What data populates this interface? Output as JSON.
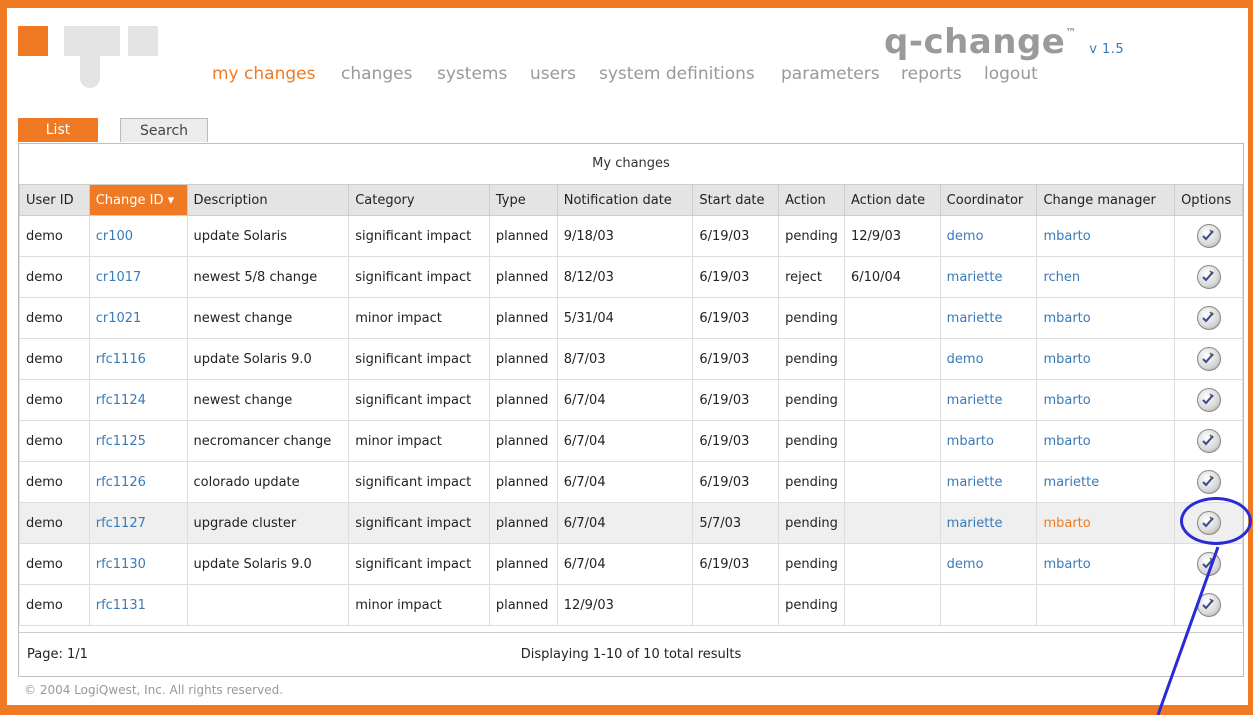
{
  "brand": {
    "name": "q-change",
    "tm": "™",
    "version": "v 1.5"
  },
  "nav": [
    "my changes",
    "changes",
    "systems",
    "users",
    "system definitions",
    "parameters",
    "reports",
    "logout"
  ],
  "tabs": {
    "list": "List",
    "search": "Search"
  },
  "table": {
    "caption": "My changes",
    "columns": [
      "User ID",
      "Change ID ▾",
      "Description",
      "Category",
      "Type",
      "Notification date",
      "Start date",
      "Action",
      "Action date",
      "Coordinator",
      "Change manager",
      "Options"
    ],
    "rows": [
      [
        "demo",
        "cr100",
        "update Solaris",
        "significant impact",
        "planned",
        "9/18/03",
        "6/19/03",
        "pending",
        "12/9/03",
        "demo",
        "mbarto"
      ],
      [
        "demo",
        "cr1017",
        "newest 5/8 change",
        "significant impact",
        "planned",
        "8/12/03",
        "6/19/03",
        "reject",
        "6/10/04",
        "mariette",
        "rchen"
      ],
      [
        "demo",
        "cr1021",
        "newest change",
        "minor impact",
        "planned",
        "5/31/04",
        "6/19/03",
        "pending",
        "",
        "mariette",
        "mbarto"
      ],
      [
        "demo",
        "rfc1116",
        "update Solaris 9.0",
        "significant impact",
        "planned",
        "8/7/03",
        "6/19/03",
        "pending",
        "",
        "demo",
        "mbarto"
      ],
      [
        "demo",
        "rfc1124",
        "newest change",
        "significant impact",
        "planned",
        "6/7/04",
        "6/19/03",
        "pending",
        "",
        "mariette",
        "mbarto"
      ],
      [
        "demo",
        "rfc1125",
        "necromancer change",
        "minor impact",
        "planned",
        "6/7/04",
        "6/19/03",
        "pending",
        "",
        "mbarto",
        "mbarto"
      ],
      [
        "demo",
        "rfc1126",
        "colorado update",
        "significant impact",
        "planned",
        "6/7/04",
        "6/19/03",
        "pending",
        "",
        "mariette",
        "mariette"
      ],
      [
        "demo",
        "rfc1127",
        "upgrade cluster",
        "significant impact",
        "planned",
        "6/7/04",
        "5/7/03",
        "pending",
        "",
        "mariette",
        "mbarto"
      ],
      [
        "demo",
        "rfc1130",
        "update Solaris 9.0",
        "significant impact",
        "planned",
        "6/7/04",
        "6/19/03",
        "pending",
        "",
        "demo",
        "mbarto"
      ],
      [
        "demo",
        "rfc1131",
        "",
        "minor impact",
        "planned",
        "12/9/03",
        "",
        "pending",
        "",
        "",
        ""
      ]
    ]
  },
  "pager": {
    "page": "Page: 1/1",
    "displaying": "Displaying 1-10 of 10 total results"
  },
  "footer": {
    "copyright": "© 2004  LogiQwest, Inc. All rights reserved."
  },
  "colors": {
    "accent": "#f07a24",
    "link": "#3a7ab8",
    "annotation": "#2a2ad8"
  },
  "icons": {
    "options": "options-edit-icon"
  }
}
